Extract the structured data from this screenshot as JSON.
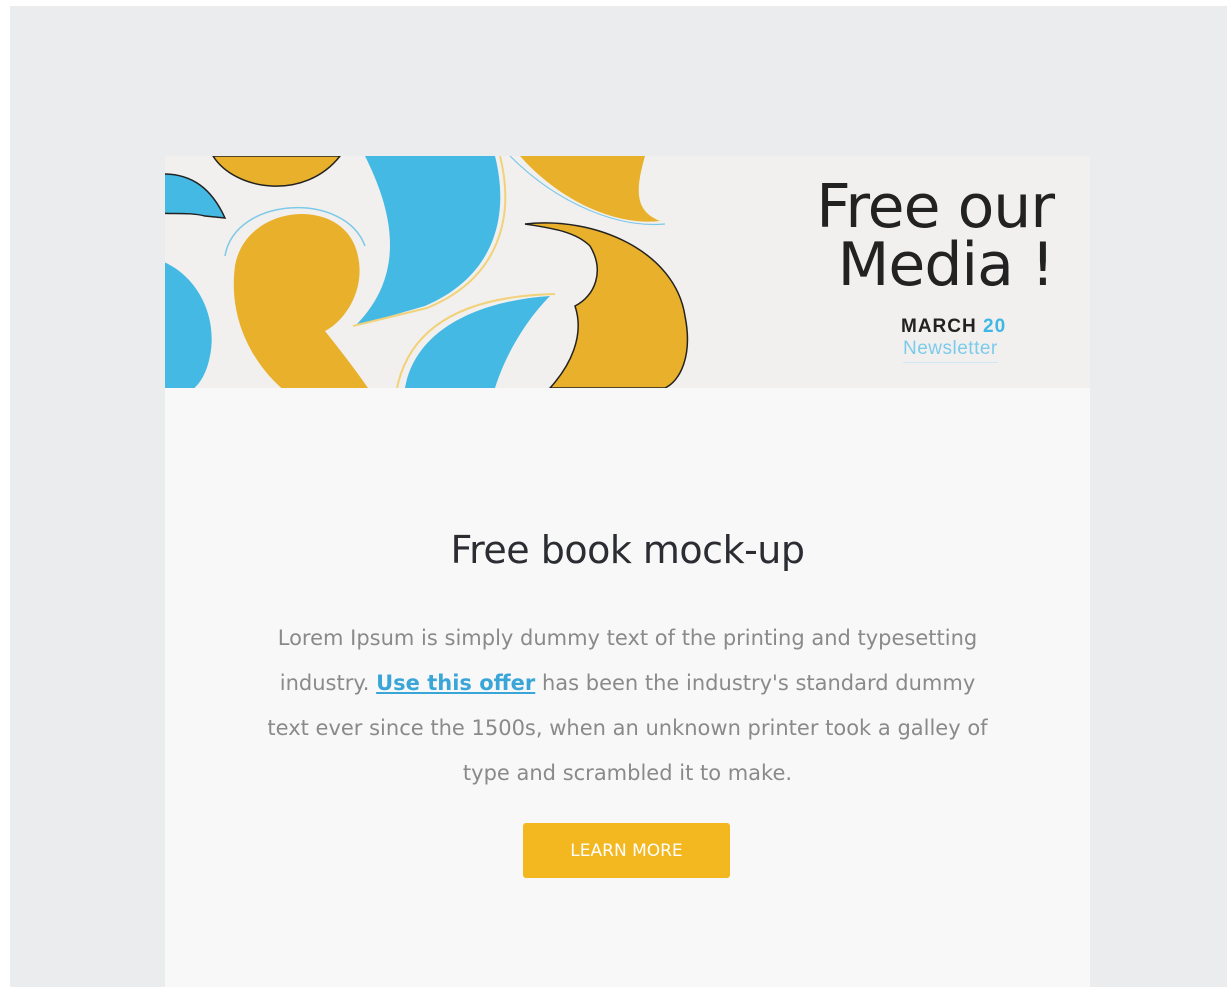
{
  "banner": {
    "title_line1": "Free our",
    "title_line2": "Media !",
    "date_month": "MARCH",
    "date_day": "20",
    "subtitle": "Newsletter"
  },
  "article": {
    "heading": "Free book mock-up",
    "text_before": "Lorem Ipsum is simply dummy text of the printing and typesetting industry. ",
    "link_label": "Use this offer",
    "text_after": " has been the industry's standard dummy text ever since the 1500s, when an unknown printer took a galley of type and scrambled it to make.",
    "button_label": "LEARN MORE"
  },
  "colors": {
    "accent_yellow": "#f3b71f",
    "accent_blue": "#3fb7e6",
    "page_bg": "#ebecee",
    "card_bg": "#f8f8f8"
  }
}
